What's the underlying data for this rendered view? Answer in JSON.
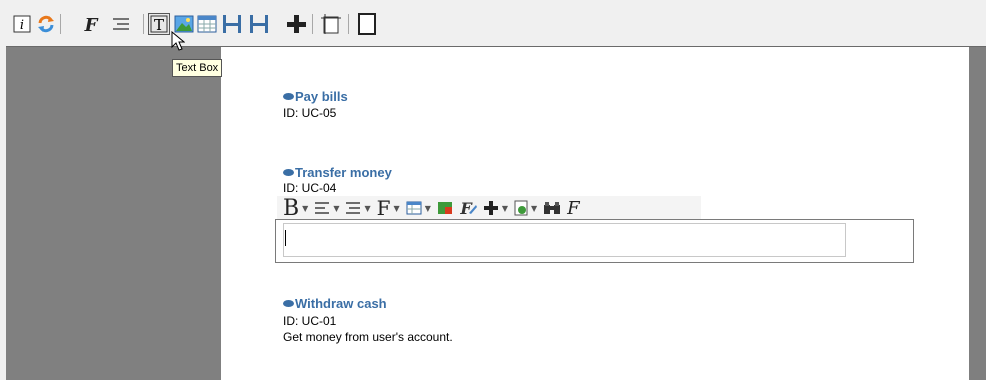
{
  "toolbar": {
    "buttons": [
      {
        "name": "info-icon",
        "glyph": "i"
      },
      {
        "name": "refresh-icon"
      },
      {
        "name": "font-icon",
        "glyph": "F"
      },
      {
        "name": "list-indent-icon"
      },
      {
        "name": "text-box-icon",
        "glyph": "T"
      },
      {
        "name": "image-icon"
      },
      {
        "name": "table-icon"
      },
      {
        "name": "page-break-icon"
      },
      {
        "name": "page-break-2-icon"
      },
      {
        "name": "add-icon"
      },
      {
        "name": "page-frame-icon"
      },
      {
        "name": "blank-page-icon"
      }
    ],
    "tooltip": "Text Box"
  },
  "document": {
    "use_cases": [
      {
        "title": "Pay bills",
        "id": "ID: UC-05"
      },
      {
        "title": "Transfer money",
        "id": "ID: UC-04"
      },
      {
        "title": "Withdraw cash",
        "id": "ID: UC-01",
        "description": "Get money from user's account."
      }
    ]
  },
  "inline_toolbar": {
    "bold_label": "B",
    "font_label": "F",
    "find_font_label": "F"
  },
  "editor": {
    "value": ""
  },
  "colors": {
    "accent": "#3a6ea5",
    "workspace": "#808080",
    "page": "#ffffff"
  }
}
